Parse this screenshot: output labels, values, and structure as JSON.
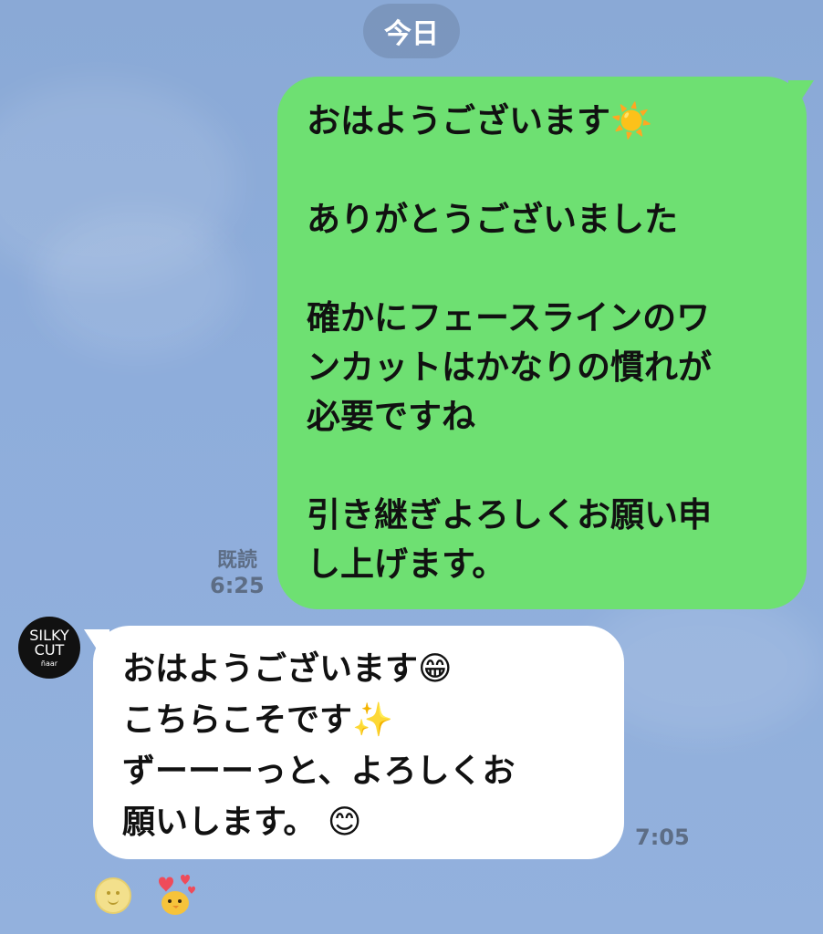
{
  "date_divider": "今日",
  "outgoing_message": {
    "text": "おはようございます☀️\n\nありがとうございました\n\n確かにフェースラインのワ\nンカットはかなりの慣れが\n必要ですね\n\n引き継ぎよろしくお願い申\nし上げます。",
    "read_status": "既読",
    "time": "6:25"
  },
  "incoming_message": {
    "avatar_lines": [
      "SILKY",
      "CUT",
      "ñaar"
    ],
    "text": "おはようございます😁\nこちらこそです✨\nずーーーっと、よろしくお\n願いします。 😊",
    "time": "7:05"
  },
  "reactions": [
    {
      "icon": "smiley-reaction-icon"
    },
    {
      "icon": "heart-chick-sticker-icon"
    }
  ],
  "colors": {
    "outgoing_bubble": "#6ee072",
    "incoming_bubble": "#ffffff",
    "background": "#8eaddb"
  }
}
